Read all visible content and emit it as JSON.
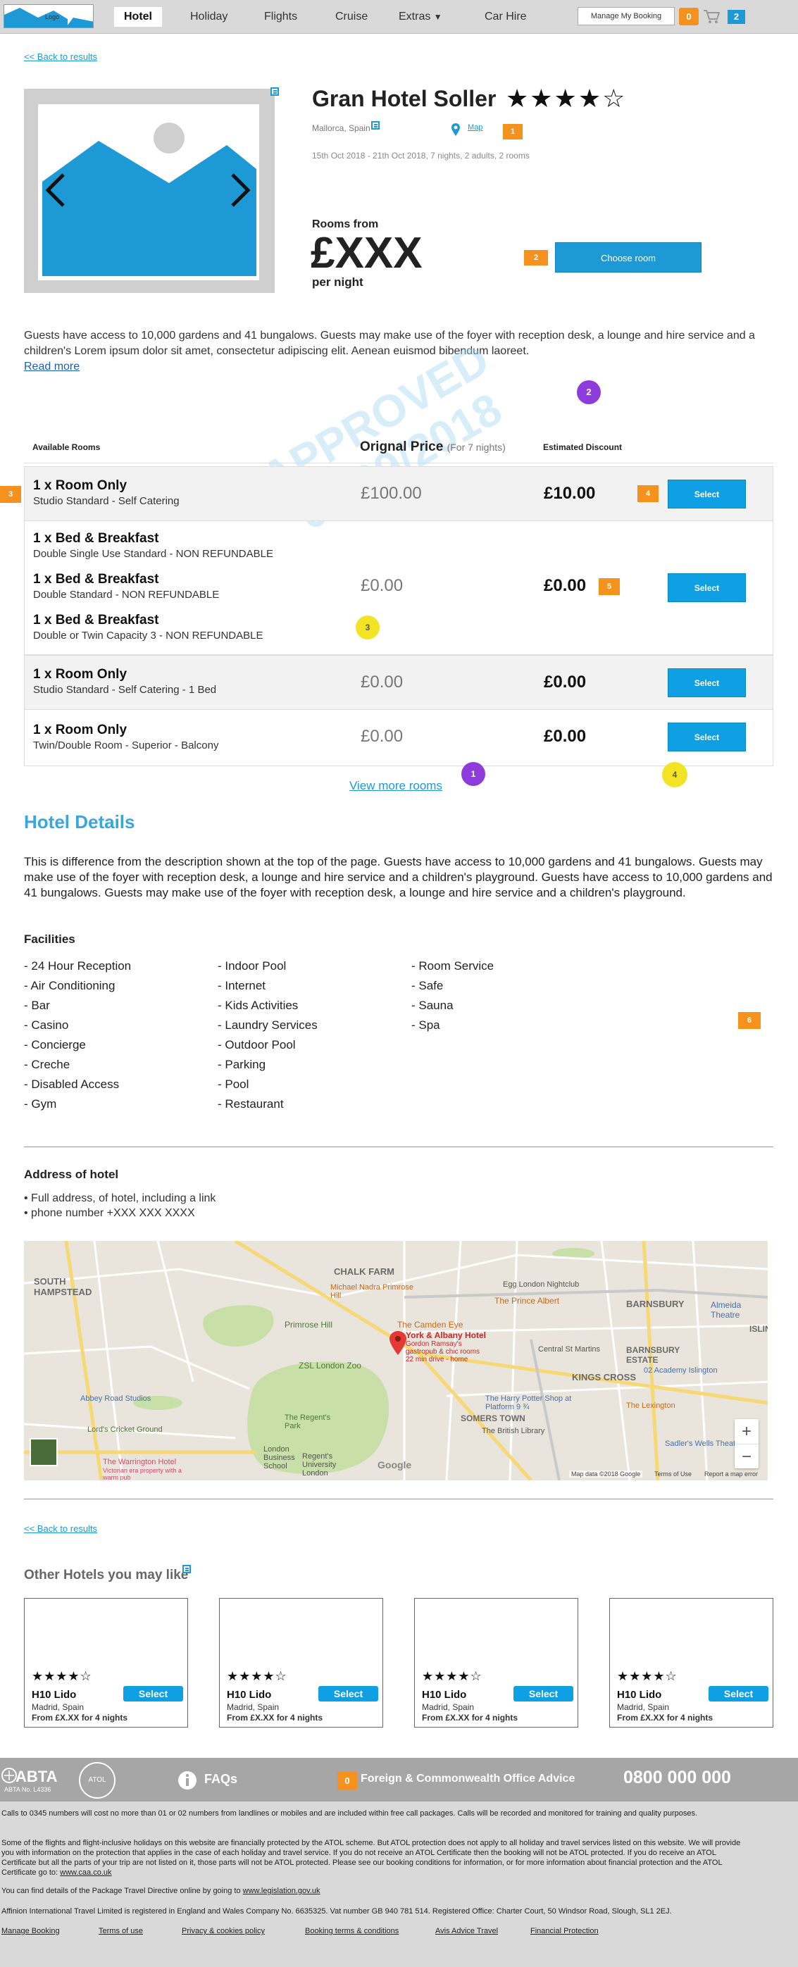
{
  "nav": {
    "logo_text": "Logo",
    "items": [
      "Hotel",
      "Holiday",
      "Flights",
      "Cruise",
      "Extras",
      "Car Hire"
    ],
    "extras_arrow": "▼",
    "manage_booking": "Manage My Booking",
    "badge_count": "0",
    "cart_count": "2"
  },
  "back_link": "<< Back to results",
  "hotel": {
    "name": "Gran Hotel Soller",
    "stars": "★★★★☆",
    "location": "Mallorca, Spain",
    "map_label": "Map",
    "dates": "15th Oct 2018 - 21th Oct 2018, 7 nights, 2 adults, 2 rooms",
    "rooms_from": "Rooms from",
    "price": "£XXX",
    "per_night": "per night",
    "choose_room": "Choose room",
    "description": "Guests have access to 10,000 gardens and 41 bungalows. Guests may make use of the foyer with reception desk, a lounge and hire service and a children's Lorem ipsum dolor sit amet, consectetur adipiscing elit. Aenean euismod bibendum laoreet.",
    "read_more": "Read more"
  },
  "flags": {
    "f1": "1",
    "f2": "2",
    "f3": "3",
    "f4": "4",
    "f5": "5",
    "f6": "6"
  },
  "circles": {
    "c2": "2",
    "c3": "3",
    "c1": "1",
    "c4": "4"
  },
  "watermark": {
    "line1": "APPROVED",
    "line2": "06/09/2018"
  },
  "rooms": {
    "col_available": "Available Rooms",
    "col_price": "Orignal Price",
    "col_price_note": "(For 7 nights)",
    "col_discount": "Estimated Discount",
    "select_label": "Select",
    "list": [
      {
        "title": "1 x Room Only",
        "sub": "Studio Standard - Self Catering",
        "price": "£100.00",
        "discount": "£10.00"
      },
      {
        "title": "1 x Bed & Breakfast",
        "sub": "Double Single Use Standard - NON REFUNDABLE"
      },
      {
        "title": "1 x Bed & Breakfast",
        "sub": "Double Standard - NON REFUNDABLE",
        "price": "£0.00",
        "discount": "£0.00"
      },
      {
        "title": "1 x Bed & Breakfast",
        "sub": "Double or Twin Capacity 3 - NON REFUNDABLE"
      },
      {
        "title": "1 x Room Only",
        "sub": "Studio Standard - Self Catering - 1 Bed",
        "price": "£0.00",
        "discount": "£0.00"
      },
      {
        "title": "1 x Room Only",
        "sub": "Twin/Double Room - Superior - Balcony",
        "price": "£0.00",
        "discount": "£0.00"
      }
    ],
    "view_more": "View more rooms"
  },
  "details": {
    "title": "Hotel Details",
    "text": "This is difference from the description shown at the top of the page. Guests have access to 10,000 gardens and 41 bungalows. Guests may make use of the foyer with reception desk, a lounge and hire service and a children's playground. Guests have access to 10,000 gardens and 41 bungalows. Guests may make use of the foyer with reception desk, a lounge and hire service and a children's playground.",
    "facilities_title": "Facilities",
    "facilities_col1": [
      "- 24 Hour Reception",
      "- Air Conditioning",
      "- Bar",
      "- Casino",
      "- Concierge",
      "- Creche",
      "- Disabled Access",
      "- Gym"
    ],
    "facilities_col2": [
      "- Indoor Pool",
      "- Internet",
      "- Kids Activities",
      "- Laundry Services",
      "- Outdoor Pool",
      "- Parking",
      "- Pool",
      "- Restaurant"
    ],
    "facilities_col3": [
      "- Room Service",
      "- Safe",
      "- Sauna",
      "- Spa"
    ]
  },
  "address": {
    "title": "Address of hotel",
    "line1": "• Full address, of hotel, including a link",
    "line2": "• phone number +XXX XXX XXXX"
  },
  "map": {
    "labels": [
      "SOUTH HAMPSTEAD",
      "CHALK FARM",
      "Primrose Hill",
      "BARNSBURY",
      "BARNSBURY ESTATE",
      "KINGS CROSS",
      "SOMERS TOWN",
      "The Regent's Park",
      "London Business School",
      "Regent's University London",
      "Abbey Road Studios",
      "Lord's Cricket Ground",
      "ZSL London Zoo",
      "The Camden Eye",
      "Egg London Nightclub",
      "The Prince Albert",
      "Almeida Theatre",
      "02 Academy Islington",
      "The Lexington",
      "Sadler's Wells Theatre",
      "The British Library",
      "Central St Martins",
      "The Warrington Hotel",
      "Michael Nadra Primrose Hill",
      "ISLIN",
      "The Harry Potter Shop at Platform 9 ¾"
    ],
    "hotel_name": "York & Albany Hotel",
    "hotel_sub1": "Gordon Ramsay's",
    "hotel_sub2": "gastropub & chic rooms",
    "hotel_sub3": "22 min drive - home",
    "warrington_sub": "Victorian era property with a warm pub",
    "zoom_in": "+",
    "zoom_out": "−",
    "attribution": "Map data ©2018 Google",
    "terms": "Terms of Use",
    "report": "Report a map error",
    "google": "Google"
  },
  "other_hotels": {
    "title": "Other Hotels you may like",
    "cards": [
      {
        "stars": "★★★★☆",
        "name": "H10 Lido",
        "location": "Madrid, Spain",
        "price": "From £X.XX for 4 nights",
        "btn": "Select"
      },
      {
        "stars": "★★★★☆",
        "name": "H10 Lido",
        "location": "Madrid, Spain",
        "price": "From £X.XX for 4 nights",
        "btn": "Select"
      },
      {
        "stars": "★★★★☆",
        "name": "H10 Lido",
        "location": "Madrid, Spain",
        "price": "From £X.XX for 4 nights",
        "btn": "Select"
      },
      {
        "stars": "★★★★☆",
        "name": "H10 Lido",
        "location": "Madrid, Spain",
        "price": "From £X.XX for 4 nights",
        "btn": "Select"
      }
    ]
  },
  "footer": {
    "abta": "ABTA",
    "abta_no": "ABTA No. L4336",
    "atol": "ATOL",
    "faqs": "FAQs",
    "fco_badge": "0",
    "fco": "Foreign & Commonwealth Office Advice",
    "phone": "0800 000 000",
    "p1": "Calls to 0345 numbers will cost no more than 01 or 02 numbers from landlines or mobiles and are included within free call packages. Calls will be recorded and monitored for training and quality purposes.",
    "p2": "Some of the flights and flight-inclusive holidays on this website are financially protected by the ATOL scheme. But ATOL protection does not apply to all holiday and travel services listed on this website. We will provide you with information on the protection that applies in the case of each holiday and travel service. If you do not receive an ATOL Certificate then the booking will not be ATOL protected. If you do receive an ATOL Certificate but all the parts of your trip are not listed on it, those parts will not be ATOL protected. Please see our booking conditions for information, or for more information about financial protection and the ATOL Certificate go to:",
    "p2_link": "www.caa.co.uk",
    "p3": "You can find details of the Package Travel Directive online by going to",
    "p3_link": "www.legislation.gov.uk",
    "p4": "Affinion International Travel Limited is registered in England and Wales Company No. 6635325. Vat number GB 940 781 514. Registered Office: Charter Court, 50 Windsor Road, Slough, SL1 2EJ.",
    "links": [
      "Manage Booking",
      "Terms of use",
      "Privacy & cookies policy",
      "Booking terms & conditions",
      "Avis Advice Travel",
      "Financial Protection"
    ]
  },
  "colors": {
    "accent": "#1d9ad6",
    "orange": "#f5921e",
    "purple": "#8e3bdb",
    "yellow": "#f2e324"
  }
}
